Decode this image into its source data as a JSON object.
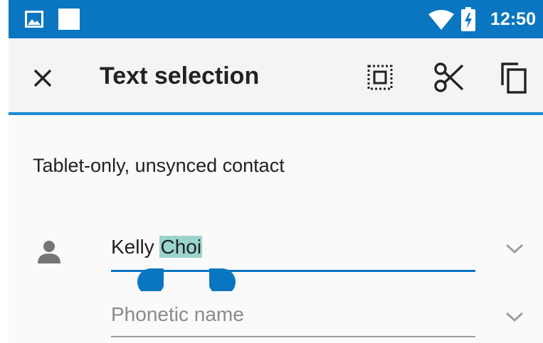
{
  "status_bar": {
    "time": "12:50",
    "icons": [
      "image-notification-icon",
      "blank-notification-icon",
      "wifi-icon",
      "battery-icon"
    ],
    "color": "#0a76c2"
  },
  "action_bar": {
    "title": "Text selection",
    "close_icon": "close-icon",
    "select_all_icon": "select-all-icon",
    "cut_icon": "cut-icon",
    "copy_icon": "copy-icon",
    "accent_color": "#1a8ad4"
  },
  "content": {
    "account_text": "Tablet-only, unsynced contact",
    "name_field": {
      "before_selection": "Kelly ",
      "selected": "Choi",
      "icon": "person-icon",
      "expand_icon": "chevron-down-icon",
      "selection_color": "#9bd4cc"
    },
    "phonetic_field": {
      "placeholder": "Phonetic name",
      "expand_icon": "chevron-down-icon"
    }
  }
}
